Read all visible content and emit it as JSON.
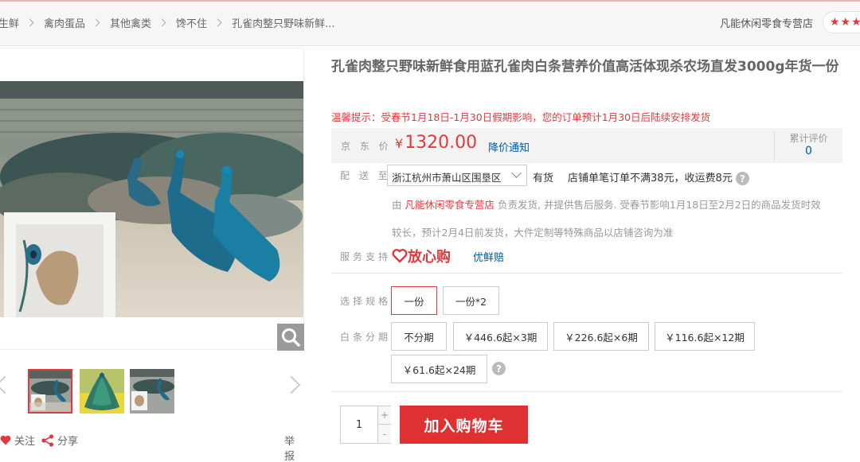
{
  "breadcrumb": {
    "items": [
      "生鲜",
      "禽肉蛋品",
      "其他禽类",
      "馋不住",
      "孔雀肉整只野味新鲜..."
    ]
  },
  "header": {
    "store_name": "凡能休闲零食专营店",
    "rating_stars": "★★★"
  },
  "gallery": {
    "thumbnail_count": 3,
    "follow_label": "关注",
    "share_label": "分享",
    "report_label": "举报"
  },
  "product": {
    "title": "孔雀肉整只野味新鲜食用蓝孔雀肉白条营养价值高活体现杀农场直发3000g年货一份",
    "notice": "温馨提示：受春节1月18日-1月30日假期影响，您的订单预计1月30日后陆续安排发货",
    "price_label": "京 东 价",
    "currency": "¥",
    "price": "1320.00",
    "price_drop_label": "降价通知",
    "reviews_label": "累计评价",
    "reviews_count": "0"
  },
  "shipping": {
    "label": "配 送 至",
    "region": "浙江杭州市萧山区围垦区",
    "stock": "有货",
    "freight": "店铺单笔订单不满38元，收运费8元",
    "info_prefix": "由",
    "info_shop": "凡能休闲零食专营店",
    "info_line1_rest": "负责发货, 并提供售后服务. 受春节影响1月18日至2月2日的商品发货时效",
    "info_line2": "较长，预计2月4日前发货，大件定制等特殊商品以店铺咨询为准"
  },
  "service": {
    "label": "服务支持",
    "logo_text": "放心购",
    "extra": "优鲜赔"
  },
  "spec": {
    "label": "选择规格",
    "options": [
      "一份",
      "一份*2"
    ],
    "selected_index": 0
  },
  "installment": {
    "label": "白条分期",
    "options": [
      "不分期",
      "￥446.6起×3期",
      "￥226.6起×6期",
      "￥116.6起×12期",
      "￥61.6起×24期"
    ]
  },
  "purchase": {
    "quantity": "1",
    "plus": "+",
    "minus": "-",
    "add_to_cart": "加入购物车"
  },
  "colors": {
    "accent_red": "#e4393c",
    "link_blue": "#005aa0"
  }
}
